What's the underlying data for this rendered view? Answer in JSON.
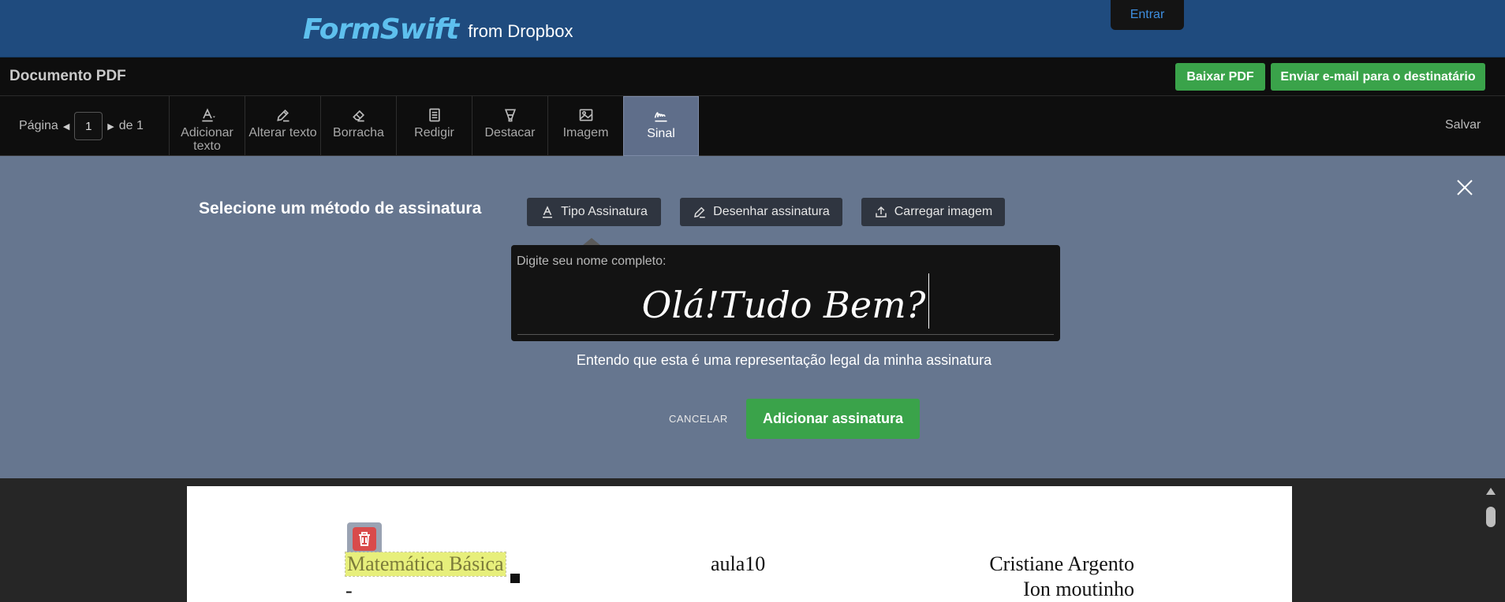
{
  "header": {
    "logo_text": "FormSwift",
    "logo_from": "from Dropbox",
    "login_label": "Entrar"
  },
  "docbar": {
    "title": "Documento PDF",
    "download_label": "Baixar PDF",
    "email_label": "Enviar e-mail para o destinatário"
  },
  "toolbar": {
    "page_label": "Página",
    "page_value": "1",
    "page_of": "de 1",
    "tools": {
      "add_text": "Adicionar texto",
      "edit_text": "Alterar texto",
      "eraser": "Borracha",
      "redact": "Redigir",
      "highlight": "Destacar",
      "image": "Imagem",
      "sign": "Sinal"
    },
    "save_label": "Salvar"
  },
  "signature": {
    "heading": "Selecione um método de assinatura",
    "methods": {
      "type": "Tipo Assinatura",
      "draw": "Desenhar assinatura",
      "upload": "Carregar imagem"
    },
    "input_label": "Digite seu nome completo:",
    "input_value": "Olá!Tudo Bem?",
    "legal_text": "Entendo que esta é uma representação legal da minha assinatura",
    "cancel_label": "CANCELAR",
    "add_label": "Adicionar assinatura"
  },
  "document": {
    "subject": "Matemática Básica",
    "lesson": "aula10",
    "author1": "Cristiane Argento",
    "author2": "Ion moutinho",
    "dash": "-"
  },
  "colors": {
    "header_bg": "#1f4b7e",
    "primary_green": "#3aa34a",
    "panel_bg": "#66768f",
    "highlight": "#e7ef7b"
  }
}
